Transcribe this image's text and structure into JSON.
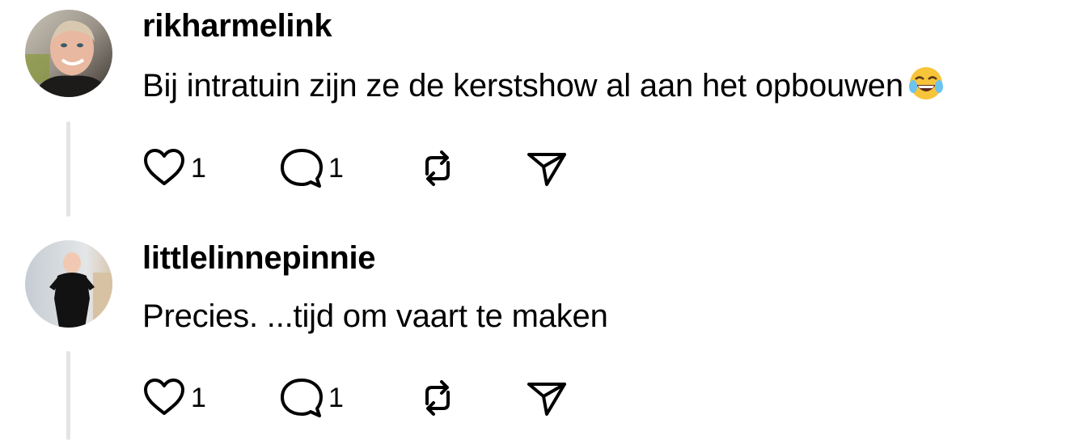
{
  "posts": [
    {
      "username": "rikharmelink",
      "text": "Bij intratuin zijn ze de kerstshow al aan het opbouwen",
      "emoji": "face-with-tears-of-joy",
      "avatar_icon": "user-avatar-man-smiling",
      "likes": "1",
      "replies": "1",
      "icons": [
        "heart-icon",
        "comment-icon",
        "repost-icon",
        "share-icon"
      ]
    },
    {
      "username": "littlelinnepinnie",
      "text": "Precies. ...tijd om vaart te maken",
      "avatar_icon": "user-avatar-child",
      "likes": "1",
      "replies": "1",
      "icons": [
        "heart-icon",
        "comment-icon",
        "repost-icon",
        "share-icon"
      ]
    }
  ],
  "colors": {
    "text": "#000000",
    "thread_line": "#e4e4e4",
    "background": "#ffffff"
  }
}
